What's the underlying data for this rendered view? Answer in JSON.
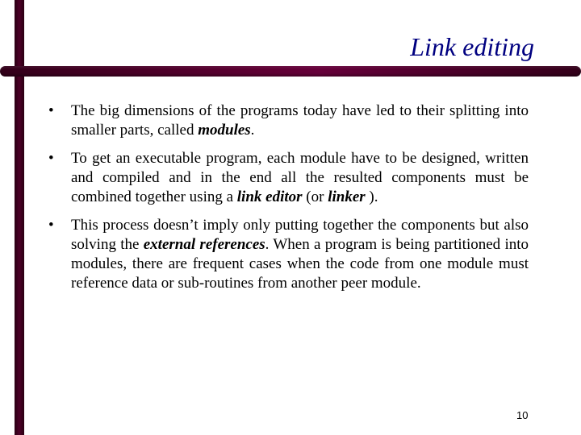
{
  "slide": {
    "title": "Link editing",
    "page_number": "10",
    "accent_colors": {
      "bar": "#4d0028",
      "title": "#000080"
    },
    "bullet_glyph": "•",
    "bullets": [
      {
        "parts": [
          {
            "text": "The big dimensions of the programs today have led to their splitting into smaller parts, called ",
            "emphasis": false
          },
          {
            "text": "modules",
            "emphasis": true
          },
          {
            "text": ".",
            "emphasis": false
          }
        ]
      },
      {
        "parts": [
          {
            "text": "To get an executable program, each module have to be designed, written and compiled and in the end all the resulted components must be combined together using a ",
            "emphasis": false
          },
          {
            "text": "link editor",
            "emphasis": true
          },
          {
            "text": " (or ",
            "emphasis": false
          },
          {
            "text": "linker",
            "emphasis": true
          },
          {
            "text": " ).",
            "emphasis": false
          }
        ]
      },
      {
        "parts": [
          {
            "text": "This process doesn’t imply only putting together the components but also solving the ",
            "emphasis": false
          },
          {
            "text": "external references",
            "emphasis": true
          },
          {
            "text": ". When a program is being partitioned into modules, there are frequent cases when the code from one module must reference data or sub-routines from another peer module.",
            "emphasis": false
          }
        ]
      }
    ]
  }
}
